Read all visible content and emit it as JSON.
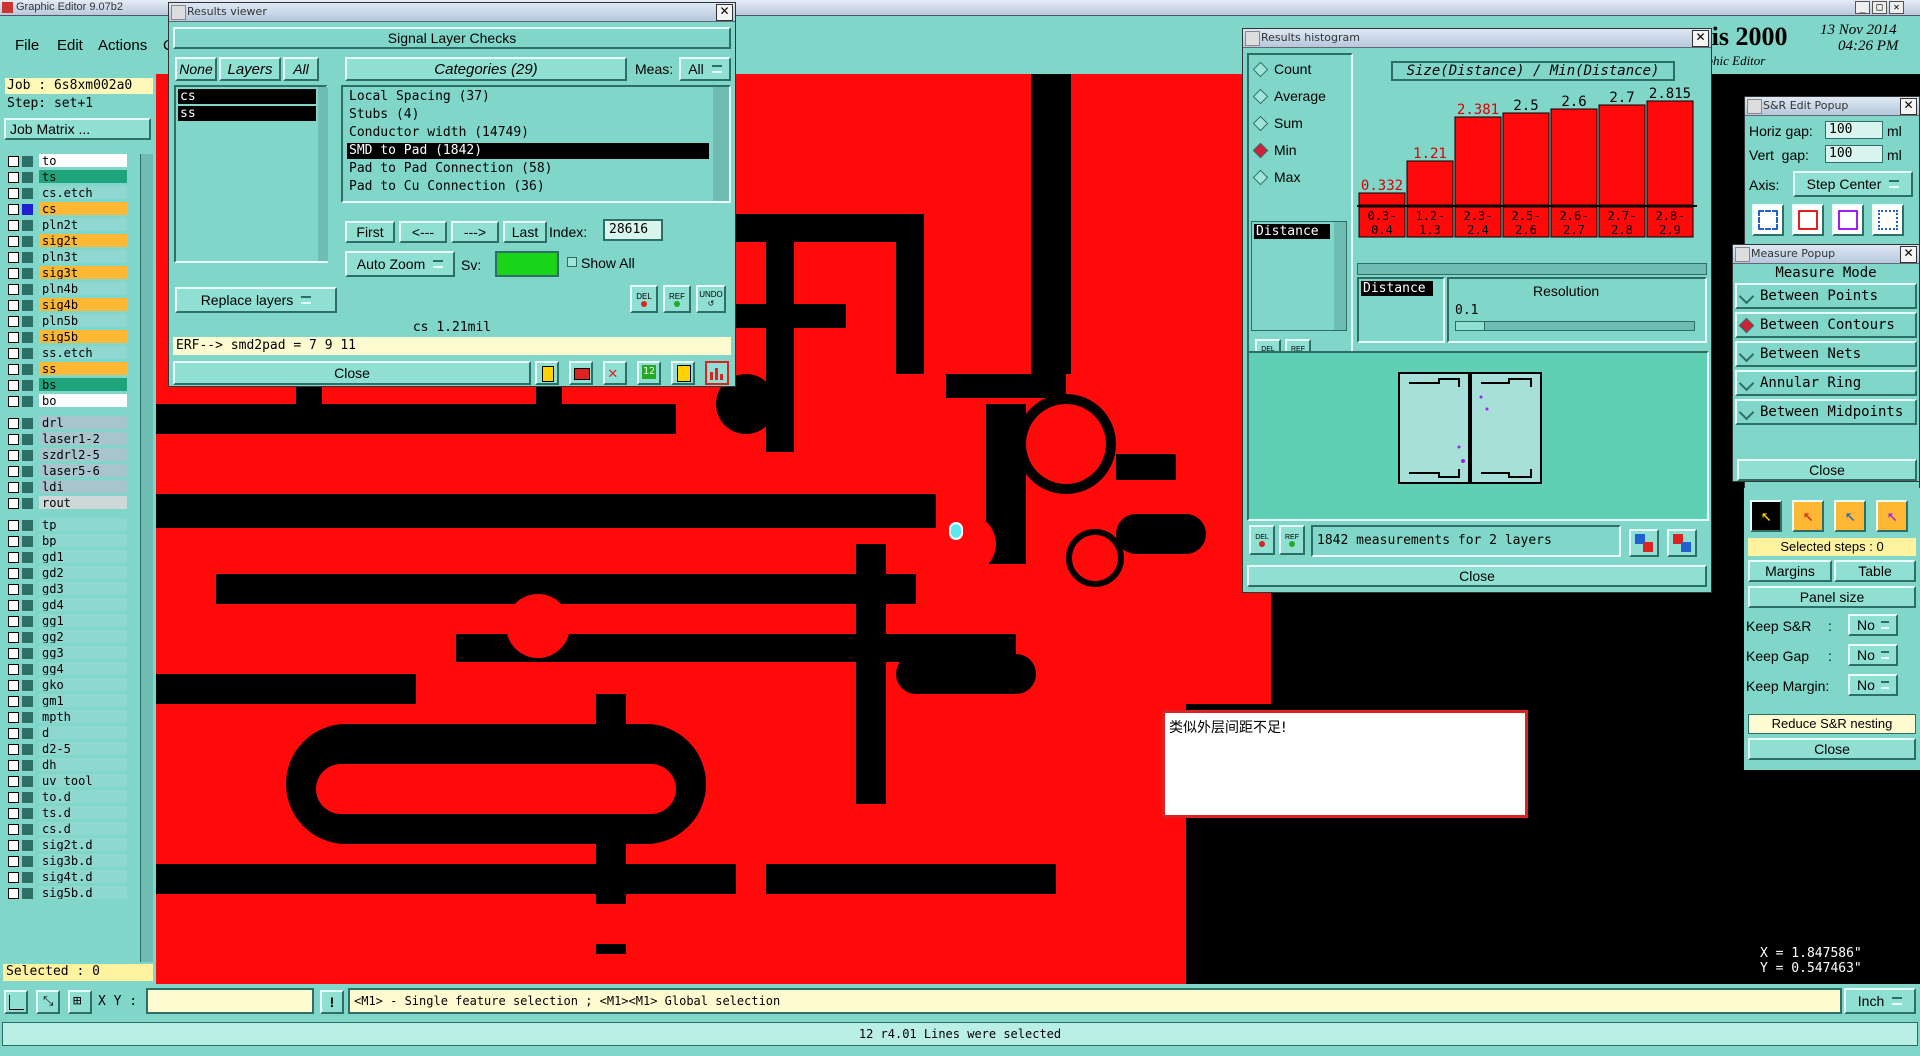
{
  "app": {
    "title": "Graphic Editor 9.07b2",
    "brand": "esis 2000",
    "date": "13 Nov 2014",
    "time": "04:26 PM",
    "subtitle": "aphic Editor"
  },
  "menu": {
    "file": "File",
    "edit": "Edit",
    "actions": "Actions",
    "more": "C"
  },
  "job": {
    "job": "Job : 6s8xm002a0",
    "step": "Step: set+1",
    "matrix_btn": "Job Matrix ..."
  },
  "layers_panel": {
    "layers": [
      {
        "name": "to",
        "bg": "#ffffff"
      },
      {
        "name": "ts",
        "bg": "#1fa37a"
      },
      {
        "name": "cs.etch",
        "bg": "#8fd8d0"
      },
      {
        "name": "cs",
        "bg": "#ffb833"
      },
      {
        "name": "pln2t",
        "bg": "#8fd8d0"
      },
      {
        "name": "sig2t",
        "bg": "#ffb833"
      },
      {
        "name": "pln3t",
        "bg": "#8fd8d0"
      },
      {
        "name": "sig3t",
        "bg": "#ffb833"
      },
      {
        "name": "pln4b",
        "bg": "#8fd8d0"
      },
      {
        "name": "sig4b",
        "bg": "#ffb833"
      },
      {
        "name": "pln5b",
        "bg": "#8fd8d0"
      },
      {
        "name": "sig5b",
        "bg": "#ffb833"
      },
      {
        "name": "ss.etch",
        "bg": "#8fd8d0"
      },
      {
        "name": "ss",
        "bg": "#ffb833"
      },
      {
        "name": "bs",
        "bg": "#1fa37a"
      },
      {
        "name": "bo",
        "bg": "#ffffff"
      },
      {
        "name": "drl",
        "bg": "#a8c4cc"
      },
      {
        "name": "laser1-2",
        "bg": "#a8c4cc"
      },
      {
        "name": "szdrl2-5",
        "bg": "#a8c4cc"
      },
      {
        "name": "laser5-6",
        "bg": "#a8c4cc"
      },
      {
        "name": "ldi",
        "bg": "#a8c4cc"
      },
      {
        "name": "rout",
        "bg": "#cfd8d8"
      },
      {
        "name": "tp",
        "bg": "#8fd8d0"
      },
      {
        "name": "bp",
        "bg": "#8fd8d0"
      },
      {
        "name": "gd1",
        "bg": "#8fd8d0"
      },
      {
        "name": "gd2",
        "bg": "#8fd8d0"
      },
      {
        "name": "gd3",
        "bg": "#8fd8d0"
      },
      {
        "name": "gd4",
        "bg": "#8fd8d0"
      },
      {
        "name": "gg1",
        "bg": "#8fd8d0"
      },
      {
        "name": "gg2",
        "bg": "#8fd8d0"
      },
      {
        "name": "gg3",
        "bg": "#8fd8d0"
      },
      {
        "name": "gg4",
        "bg": "#8fd8d0"
      },
      {
        "name": "gko",
        "bg": "#8fd8d0"
      },
      {
        "name": "gm1",
        "bg": "#8fd8d0"
      },
      {
        "name": "mpth",
        "bg": "#8fd8d0"
      },
      {
        "name": "d",
        "bg": "#8fd8d0"
      },
      {
        "name": "d2-5",
        "bg": "#8fd8d0"
      },
      {
        "name": "dh",
        "bg": "#8fd8d0"
      },
      {
        "name": "uv_tool",
        "bg": "#8fd8d0"
      },
      {
        "name": "to.d",
        "bg": "#8fd8d0"
      },
      {
        "name": "ts.d",
        "bg": "#8fd8d0"
      },
      {
        "name": "cs.d",
        "bg": "#8fd8d0"
      },
      {
        "name": "sig2t.d",
        "bg": "#8fd8d0"
      },
      {
        "name": "sig3b.d",
        "bg": "#8fd8d0"
      },
      {
        "name": "sig4t.d",
        "bg": "#8fd8d0"
      },
      {
        "name": "sig5b.d",
        "bg": "#8fd8d0"
      }
    ],
    "selected": "Selected : 0"
  },
  "results_viewer": {
    "title": "Results viewer",
    "header": "Signal Layer Checks",
    "none_btn": "None",
    "layers_label": "Layers",
    "all_btn": "All",
    "layers": [
      "cs",
      "ss"
    ],
    "categories_label": "Categories (29)",
    "meas_label": "Meas:",
    "meas_value": "All",
    "categories": [
      "Local Spacing (37)",
      "Stubs (4)",
      "Conductor width (14749)",
      "SMD to Pad (1842)",
      "Pad to Pad Connection (58)",
      "Pad to Cu Connection (36)"
    ],
    "selected_category": 3,
    "first": "First",
    "prev": "<---",
    "next": "--->",
    "last": "Last",
    "index_label": "Index:",
    "index_value": "28616",
    "auto_zoom": "Auto Zoom",
    "sv_label": "Sv:",
    "show_all": "Show All",
    "replace_layers": "Replace layers",
    "del": "DEL",
    "ref": "REF",
    "undo": "UNDO",
    "status": "cs 1.21mil",
    "erf": "ERF--> smd2pad = 7 9 11",
    "close": "Close"
  },
  "histogram": {
    "title": "Results histogram",
    "options": [
      "Count",
      "Average",
      "Sum",
      "Min",
      "Max"
    ],
    "selected_option": "Min",
    "heading": "Size(Distance) / Min(Distance)",
    "distance_item": "Distance",
    "bars": [
      {
        "value": "0.332",
        "range": "0.3- 0.4",
        "level": 0.06,
        "red_label": true
      },
      {
        "value": "1.21",
        "range": "1.2- 1.3",
        "level": 0.22,
        "red_label": true
      },
      {
        "value": "2.381",
        "range": "2.3- 2.4",
        "level": 0.44,
        "red_label": true
      },
      {
        "value": "2.5",
        "range": "2.5- 2.6",
        "level": 0.46,
        "red_label": false
      },
      {
        "value": "2.6",
        "range": "2.6- 2.7",
        "level": 0.48,
        "red_label": false
      },
      {
        "value": "2.7",
        "range": "2.7- 2.8",
        "level": 0.5,
        "red_label": false
      },
      {
        "value": "2.815",
        "range": "2.8- 2.9",
        "level": 0.52,
        "red_label": false
      }
    ],
    "distance_list": "Distance",
    "resolution_label": "Resolution",
    "resolution_value": "0.1",
    "measurements": "1842 measurements for 2 layers",
    "del": "DEL",
    "ref": "REF",
    "close": "Close"
  },
  "sr_popup": {
    "title": "S&R Edit Popup",
    "horiz_label": "Horiz gap:",
    "horiz_value": "100",
    "vert_label": "Vert  gap:",
    "vert_value": "100",
    "unit": "ml",
    "axis_label": "Axis:",
    "axis_value": "Step Center",
    "selected_steps": "Selected steps : 0",
    "margins": "Margins",
    "table": "Table",
    "panel_size": "Panel size",
    "keep_sr": "Keep S&R",
    "keep_gap": "Keep Gap",
    "keep_margin": "Keep Margin:",
    "no": "No",
    "colon": ":",
    "reduce": "Reduce S&R nesting",
    "close": "Close"
  },
  "measure_popup": {
    "title": "Measure Popup",
    "mode_label": "Measure Mode",
    "modes": [
      "Between Points",
      "Between Contours",
      "Between Nets",
      "Annular Ring",
      "Between Midpoints"
    ],
    "selected_mode": "Between Contours",
    "close": "Close"
  },
  "chinese_note": "类似外层间距不足!",
  "coords": {
    "x": "X = 1.847586\"",
    "y": "Y = 0.547463\""
  },
  "bottom": {
    "xy_label": "X Y :",
    "xy_value": "",
    "exclaim": "!",
    "hint": "<M1> - Single feature selection ; <M1><M1> Global selection",
    "unit": "Inch",
    "status": "12 r4.01 Lines were selected"
  },
  "colors": {
    "teal": "#7fd6c9",
    "copper": "#ff0a0a",
    "highlight": "#d0203a"
  }
}
